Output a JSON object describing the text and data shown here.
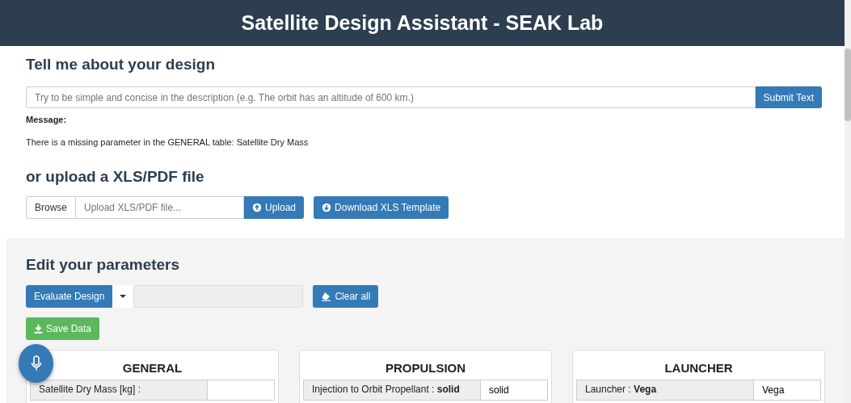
{
  "header": {
    "title": "Satellite Design Assistant - SEAK Lab"
  },
  "describe": {
    "heading": "Tell me about your design",
    "input": {
      "placeholder": "Try to be simple and concise in the description (e.g. The orbit has an altitude of 600 km.)"
    },
    "submit": "Submit Text",
    "message_label": "Message:",
    "message": "There is a missing parameter in the GENERAL table: Satellite Dry Mass"
  },
  "upload": {
    "heading": "or upload a XLS/PDF file",
    "browse": "Browse",
    "file": {
      "placeholder": "Upload XLS/PDF file..."
    },
    "upload_button": "Upload",
    "template_button": "Download XLS Template"
  },
  "parameters": {
    "heading": "Edit your parameters",
    "evaluate": "Evaluate Design",
    "clear": "Clear all",
    "save": "Save Data",
    "panels": [
      {
        "title": "GENERAL",
        "rows": [
          {
            "label": "Satellite Dry Mass [kg] :"
          }
        ]
      },
      {
        "title": "PROPULSION",
        "rows": [
          {
            "label": "Injection to Orbit Propellant : **solid**",
            "value": "solid"
          }
        ]
      },
      {
        "title": "LAUNCHER",
        "rows": [
          {
            "label": "Launcher : **Vega**",
            "value": "Vega"
          }
        ]
      }
    ]
  }
}
